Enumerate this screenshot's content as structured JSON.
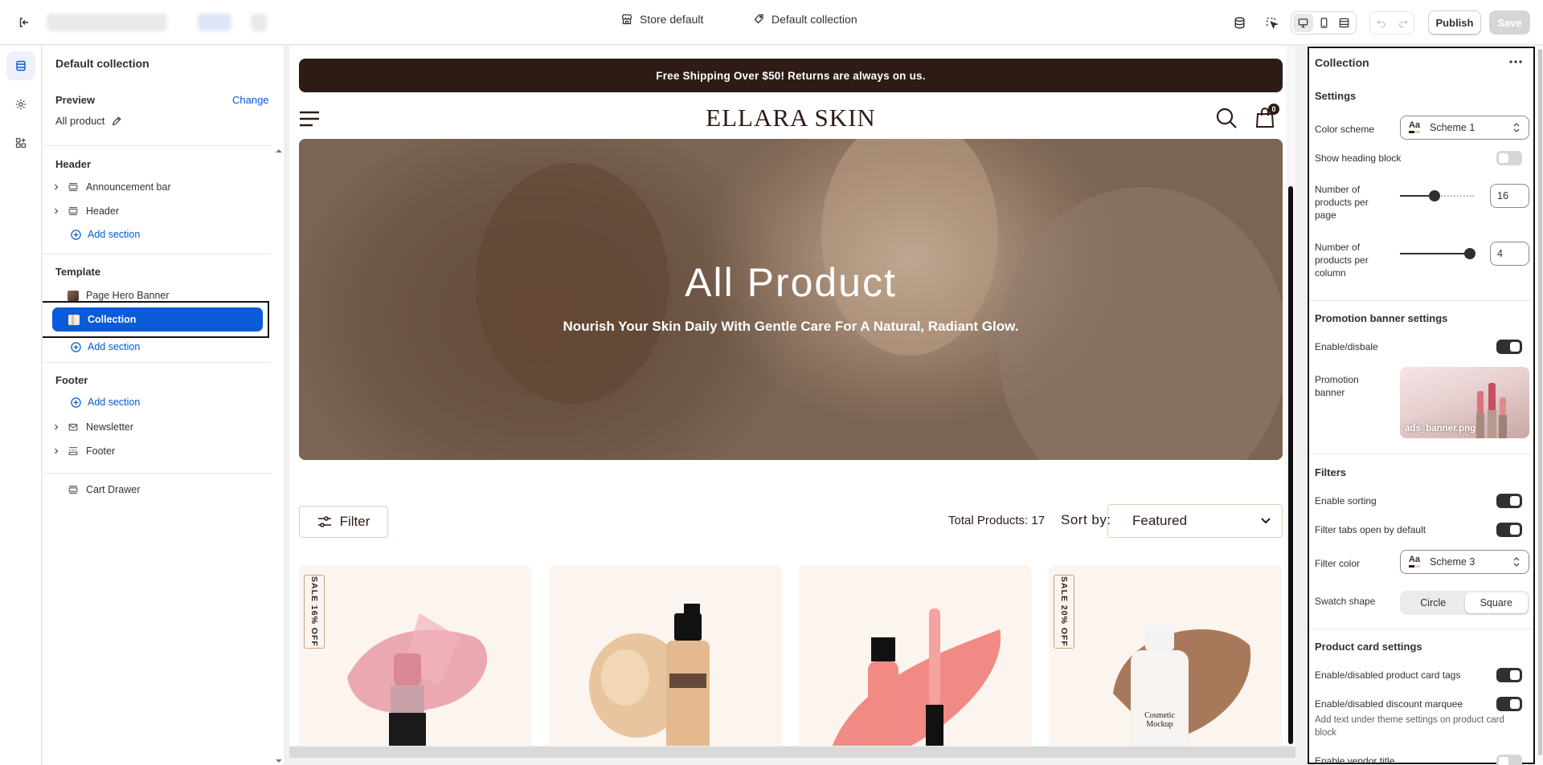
{
  "topbar": {
    "theme_label": "Store default",
    "template_label": "Default collection",
    "publish_label": "Publish",
    "save_label": "Save"
  },
  "sidebar": {
    "title": "Default collection",
    "preview_label": "Preview",
    "change_label": "Change",
    "preview_value": "All product",
    "header_group": {
      "title": "Header",
      "items": [
        "Announcement bar",
        "Header"
      ],
      "add_label": "Add section"
    },
    "template_group": {
      "title": "Template",
      "items": [
        "Page Hero Banner",
        "Collection"
      ],
      "selected": "Collection",
      "add_label": "Add section"
    },
    "footer_group": {
      "title": "Footer",
      "add_label": "Add section",
      "items": [
        "Newsletter",
        "Footer"
      ]
    },
    "cart_drawer": "Cart Drawer"
  },
  "store": {
    "announcement": "Free Shipping Over $50! Returns are always on us.",
    "logo": "ELLARA SKIN",
    "cart_count": "0",
    "hero_title": "All Product",
    "hero_subtitle": "Nourish Your Skin Daily With Gentle Care For A Natural, Radiant Glow.",
    "filter_label": "Filter",
    "total_products": "Total Products: 17",
    "sort_label": "Sort by:",
    "sort_value": "Featured",
    "cards": [
      {
        "tag": "SALE 16% OFF",
        "product": "lipstick",
        "accent": "#e89aa6"
      },
      {
        "tag": "",
        "product": "foundation",
        "accent": "#e8c59e"
      },
      {
        "tag": "",
        "product": "lip gloss",
        "accent": "#f07e78"
      },
      {
        "tag": "SALE 20% OFF",
        "product": "cosmetic mockup",
        "accent": "#a7795a",
        "bottle_text": "Cosmetic Mockup"
      }
    ]
  },
  "panel": {
    "title": "Collection",
    "settings_heading": "Settings",
    "color_scheme_label": "Color scheme",
    "color_scheme_value": "Scheme 1",
    "show_heading_label": "Show heading block",
    "show_heading_on": false,
    "per_page_label": "Number of products per page",
    "per_page_value": "16",
    "per_column_label": "Number of products per column",
    "per_column_value": "4",
    "promo_heading": "Promotion banner settings",
    "promo_enable_label": "Enable/disbale",
    "promo_enable_on": true,
    "promo_banner_label": "Promotion banner",
    "promo_banner_file": "ads_banner.png",
    "filters_heading": "Filters",
    "enable_sorting_label": "Enable sorting",
    "enable_sorting_on": true,
    "filter_tabs_label": "Filter tabs open by default",
    "filter_tabs_on": true,
    "filter_color_label": "Filter color",
    "filter_color_value": "Scheme 3",
    "swatch_label": "Swatch shape",
    "swatch_options": [
      "Circle",
      "Square"
    ],
    "swatch_selected": "Square",
    "card_heading": "Product card settings",
    "card_tags_label": "Enable/disabled product card tags",
    "card_tags_on": true,
    "discount_marquee_label": "Enable/disabled discount marquee",
    "discount_marquee_on": true,
    "marquee_help": "Add text under theme settings on product card block",
    "vendor_label": "Enable vendor title",
    "vendor_on": false
  }
}
